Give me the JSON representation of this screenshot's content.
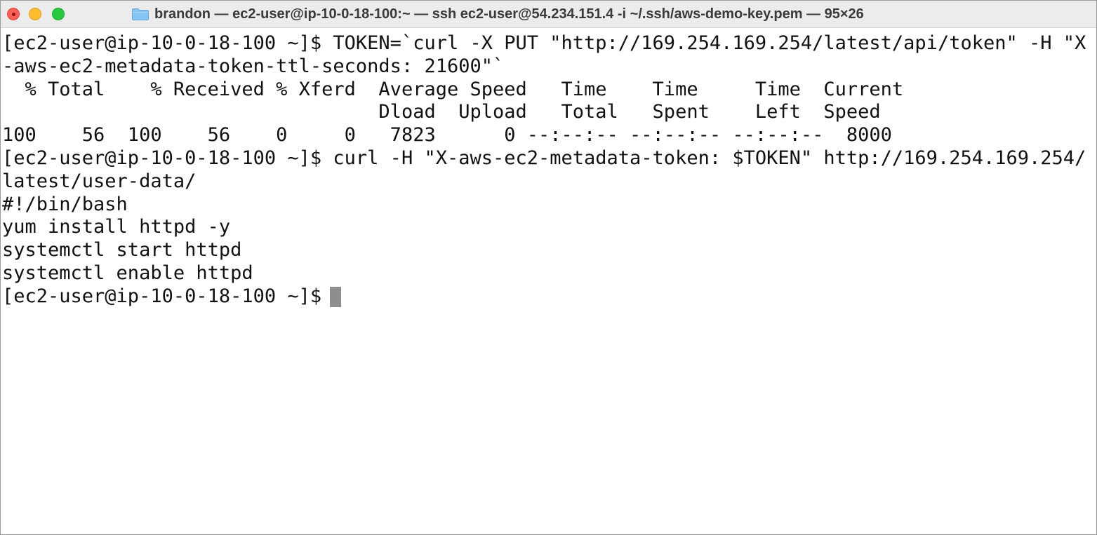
{
  "window": {
    "title": "brandon — ec2-user@ip-10-0-18-100:~ — ssh ec2-user@54.234.151.4 -i ~/.ssh/aws-demo-key.pem — 95×26"
  },
  "icons": {
    "folder": "folder-icon",
    "close": "close-icon",
    "minimize": "minimize-icon",
    "zoom": "zoom-icon"
  },
  "colors": {
    "close": "#ff5f57",
    "minimize": "#febc2e",
    "zoom": "#28c840",
    "folder": "#86c5f3",
    "cursor": "#8e8e8e"
  },
  "terminal": {
    "lines": [
      "[ec2-user@ip-10-0-18-100 ~]$ TOKEN=`curl -X PUT \"http://169.254.169.254/latest/api/token\" -H \"X",
      "-aws-ec2-metadata-token-ttl-seconds: 21600\"`",
      "  % Total    % Received % Xferd  Average Speed   Time    Time     Time  Current",
      "                                 Dload  Upload   Total   Spent    Left  Speed",
      "100    56  100    56    0     0   7823      0 --:--:-- --:--:-- --:--:--  8000",
      "[ec2-user@ip-10-0-18-100 ~]$ curl -H \"X-aws-ec2-metadata-token: $TOKEN\" http://169.254.169.254/",
      "latest/user-data/",
      "#!/bin/bash",
      "yum install httpd -y",
      "systemctl start httpd",
      "systemctl enable httpd"
    ],
    "prompt": "[ec2-user@ip-10-0-18-100 ~]$"
  }
}
